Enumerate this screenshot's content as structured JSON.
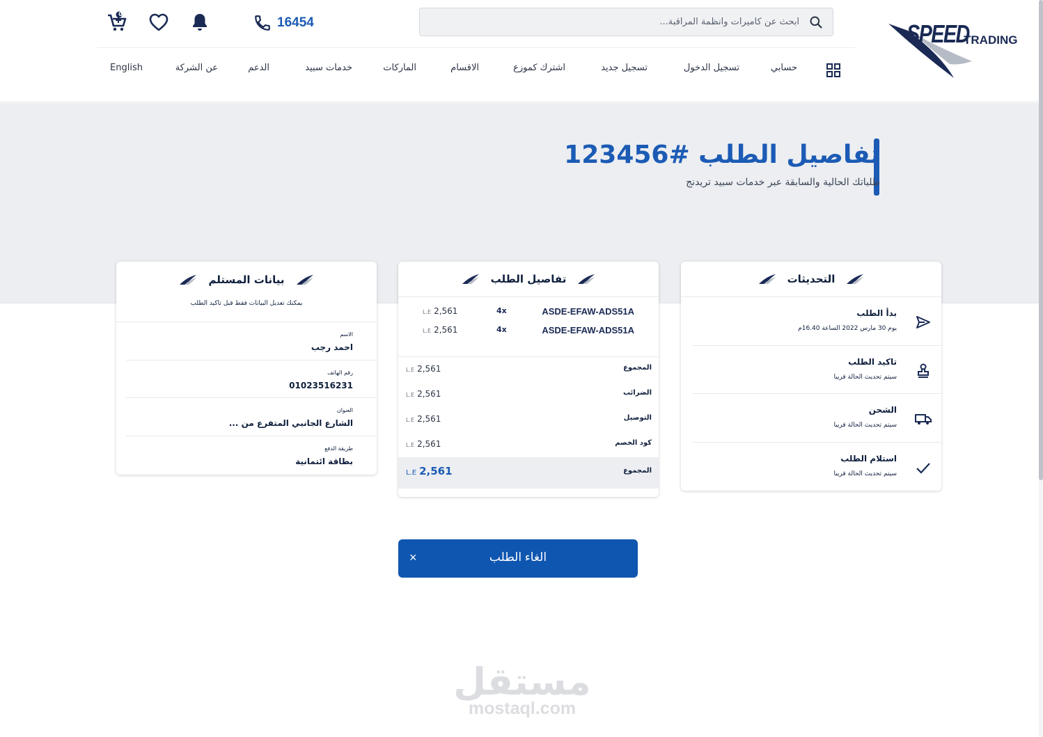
{
  "logo": {
    "speed": "SPEED",
    "trading": "TRADING"
  },
  "search": {
    "placeholder": "ابحث عن كاميرات وانظمة المراقبة..."
  },
  "phone": {
    "number": "16454"
  },
  "cart": {
    "badge": "0"
  },
  "nav": {
    "my_account": "حسابي",
    "login": "تسجيل الدخول",
    "register": "تسجيل جديد",
    "distributor": "اشترك كموزع",
    "categories": "الاقسام",
    "brands": "الماركات",
    "services": "خدمات سبيد",
    "support": "الدعم",
    "about": "عن الشركة",
    "language": "English"
  },
  "page": {
    "title": "تفاصيل الطلب #123456",
    "subtitle": "طلباتك الحالية والسابقة عبر خدمات سبيد تريدنج"
  },
  "updates": {
    "title": "التحديثات",
    "steps": [
      {
        "title": "بدأ الطلب",
        "subtitle": "يوم 30 مارس 2022 الساعة 16.40م",
        "icon": "send-icon"
      },
      {
        "title": "تاكيد الطلب",
        "subtitle": "سيتم تحديث الحالة قريبا",
        "icon": "stamp-icon"
      },
      {
        "title": "الشحن",
        "subtitle": "سيتم تحديث الحالة قريبا",
        "icon": "truck-icon"
      },
      {
        "title": "استلام الطلب",
        "subtitle": "سيتم تحديث الحالة قريبا",
        "icon": "check-icon"
      }
    ]
  },
  "order": {
    "title": "تفاصيل الطلب",
    "currency": "L.E",
    "items": [
      {
        "code": "ASDE-EFAW-ADS51A",
        "qty": "4x",
        "price": "2,561"
      },
      {
        "code": "ASDE-EFAW-ADS51A",
        "qty": "4x",
        "price": "2,561"
      }
    ],
    "summary": [
      {
        "label": "المجموع",
        "value": "2,561"
      },
      {
        "label": "الضرائب",
        "value": "2,561"
      },
      {
        "label": "التوصيل",
        "value": "2,561"
      },
      {
        "label": "كود الخصم",
        "value": "2,561"
      }
    ],
    "total": {
      "label": "المجموع",
      "value": "2,561"
    }
  },
  "recipient": {
    "title": "بيانات المستلم",
    "note": "يمكنك تعديل البيانات فقط قبل تاكيد الطلب",
    "fields": [
      {
        "label": "الاسم",
        "value": "احمد رجب"
      },
      {
        "label": "رقم الهاتف",
        "value": "01023516231"
      },
      {
        "label": "العنوان",
        "value": "الشارع الجانبي المتفرع من ..."
      },
      {
        "label": "طريقة الدفع",
        "value": "بطاقة ائتمانية"
      }
    ]
  },
  "cancel_button": {
    "label": "الغاء الطلب",
    "close": "×"
  },
  "watermark": {
    "ar": "مستقل",
    "en": "mostaql.com"
  },
  "colors": {
    "brand_blue": "#1c5bb5",
    "button_blue": "#0f56b0",
    "navy": "#1a2a55",
    "band_gray": "#eceef1"
  }
}
